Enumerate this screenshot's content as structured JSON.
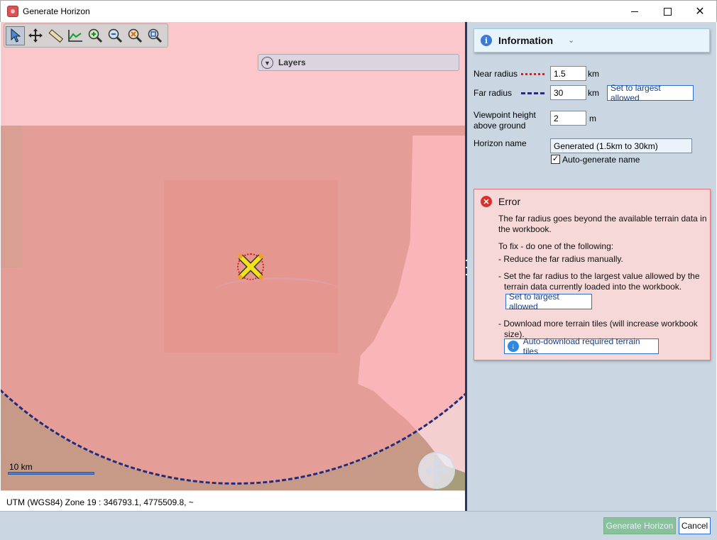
{
  "window": {
    "title": "Generate Horizon"
  },
  "map": {
    "toolbar": {
      "tools": [
        "select-tool",
        "pan-tool",
        "measure-tool",
        "elevation-profile-tool",
        "zoom-in-tool",
        "zoom-out-tool",
        "zoom-to-selection-tool",
        "zoom-extents-tool"
      ],
      "active_tool": "select-tool"
    },
    "layers_label": "Layers",
    "scale_label": "10 km",
    "status_text": "UTM (WGS84) Zone 19   : 346793.1, 4775509.8, ~"
  },
  "panel": {
    "info_title": "Information",
    "near_radius": {
      "label": "Near radius",
      "value": "1.5",
      "unit": "km"
    },
    "far_radius": {
      "label": "Far radius",
      "value": "30",
      "unit": "km",
      "button": "Set to largest allowed"
    },
    "viewpoint_height": {
      "label_line1": "Viewpoint height",
      "label_line2": "above ground",
      "value": "2",
      "unit": "m"
    },
    "horizon_name": {
      "label": "Horizon name",
      "value": "Generated (1.5km to 30km)"
    },
    "auto_generate": {
      "label": "Auto-generate name",
      "checked": true
    },
    "error": {
      "title": "Error",
      "message_line1": "The far radius goes beyond the available terrain data in",
      "message_line2": "the workbook.",
      "fix_intro": "To fix - do one of the following:",
      "option1": "- Reduce the far radius manually.",
      "option2_line1": "- Set the far radius to the largest value allowed by the",
      "option2_line2": "terrain data currently loaded into the workbook.",
      "option2_button": "Set to largest allowed",
      "option3_line1": "- Download more terrain tiles (will increase workbook",
      "option3_line2": "size).",
      "option3_button": "Auto-download required terrain tiles"
    }
  },
  "footer": {
    "generate_button": "Generate Horizon",
    "cancel_button": "Cancel"
  },
  "colors": {
    "accent": "#2f6fd0",
    "panel_bg": "#cad6e2",
    "error_bg": "#f6d8d8",
    "near_radius_line": "#d42020",
    "far_radius_line": "#1f2d7a",
    "generate_disabled": "#88c29a"
  }
}
